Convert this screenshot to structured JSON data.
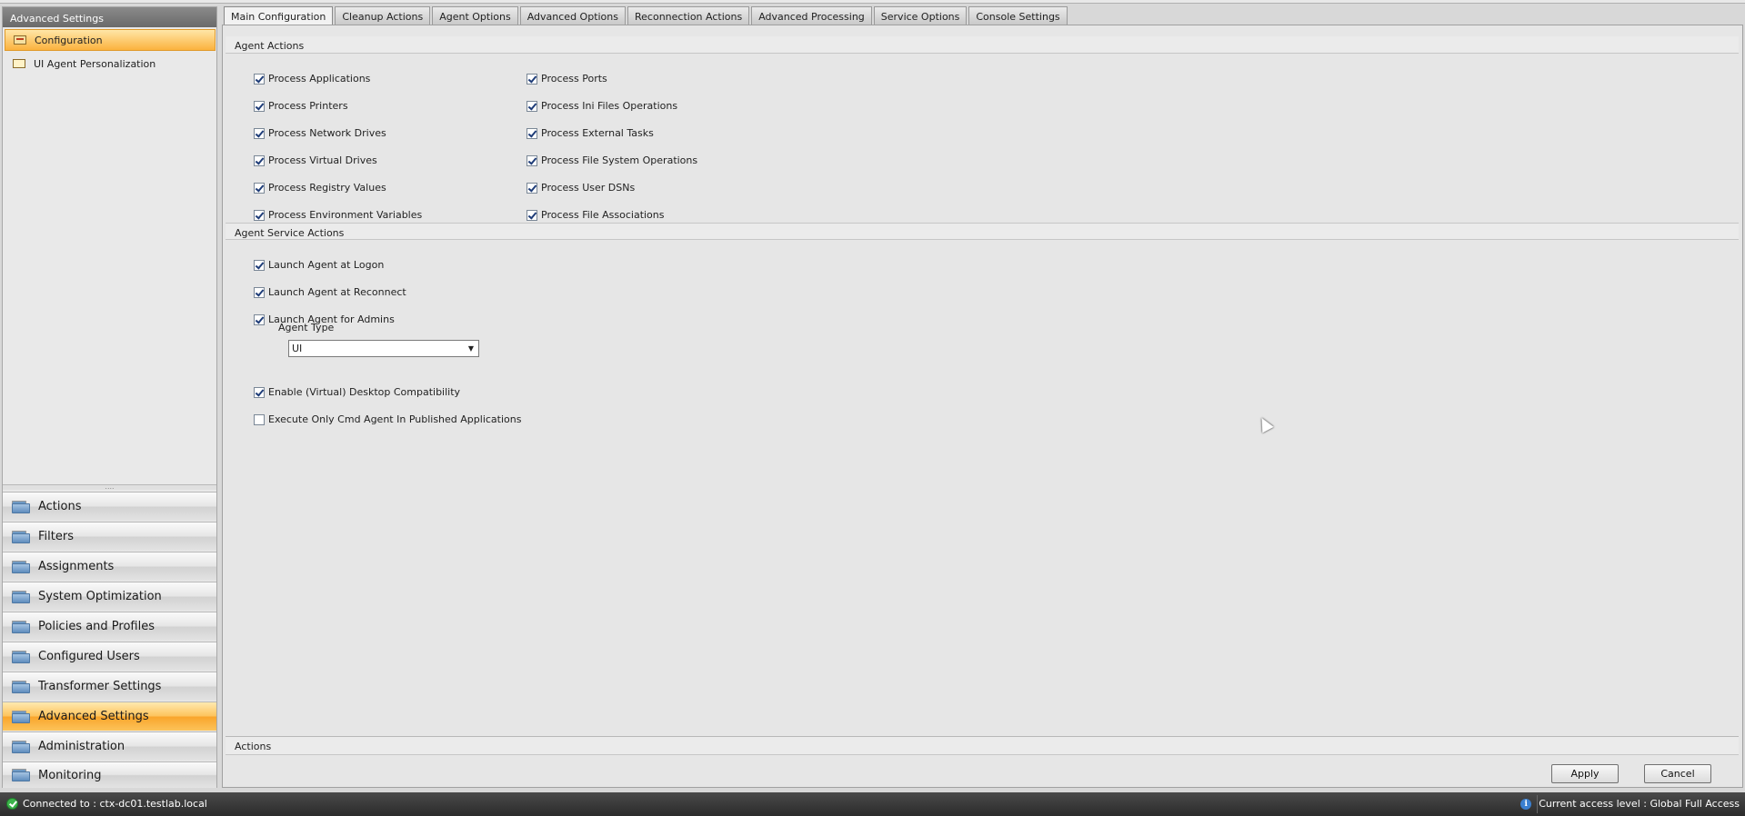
{
  "left_panel": {
    "title": "Advanced Settings",
    "tree": [
      {
        "label": "Configuration",
        "selected": true,
        "icon": "configuration-icon"
      },
      {
        "label": "UI Agent Personalization",
        "selected": false,
        "icon": "personalization-icon"
      }
    ],
    "nav": [
      {
        "label": "Actions",
        "icon": "folder-icon"
      },
      {
        "label": "Filters",
        "icon": "folder-icon"
      },
      {
        "label": "Assignments",
        "icon": "folder-icon"
      },
      {
        "label": "System Optimization",
        "icon": "folder-icon"
      },
      {
        "label": "Policies and Profiles",
        "icon": "folder-icon"
      },
      {
        "label": "Configured Users",
        "icon": "folder-icon"
      },
      {
        "label": "Transformer Settings",
        "icon": "folder-icon"
      },
      {
        "label": "Advanced Settings",
        "icon": "folder-icon",
        "active": true
      },
      {
        "label": "Administration",
        "icon": "folder-icon"
      },
      {
        "label": "Monitoring",
        "icon": "folder-icon"
      }
    ]
  },
  "tabs": [
    {
      "label": "Main Configuration",
      "active": true
    },
    {
      "label": "Cleanup Actions"
    },
    {
      "label": "Agent Options"
    },
    {
      "label": "Advanced Options"
    },
    {
      "label": "Reconnection Actions"
    },
    {
      "label": "Advanced Processing"
    },
    {
      "label": "Service Options"
    },
    {
      "label": "Console Settings"
    }
  ],
  "agent_actions": {
    "title": "Agent Actions",
    "col1": [
      {
        "label": "Process Applications",
        "checked": true
      },
      {
        "label": "Process Printers",
        "checked": true
      },
      {
        "label": "Process Network Drives",
        "checked": true
      },
      {
        "label": "Process Virtual Drives",
        "checked": true
      },
      {
        "label": "Process Registry Values",
        "checked": true
      },
      {
        "label": "Process Environment Variables",
        "checked": true
      }
    ],
    "col2": [
      {
        "label": "Process Ports",
        "checked": true
      },
      {
        "label": "Process Ini Files Operations",
        "checked": true
      },
      {
        "label": "Process External Tasks",
        "checked": true
      },
      {
        "label": "Process File System Operations",
        "checked": true
      },
      {
        "label": "Process User DSNs",
        "checked": true
      },
      {
        "label": "Process File Associations",
        "checked": true
      }
    ]
  },
  "agent_service_actions": {
    "title": "Agent Service Actions",
    "launch": [
      {
        "label": "Launch Agent at Logon",
        "checked": true
      },
      {
        "label": "Launch Agent at Reconnect",
        "checked": true
      },
      {
        "label": "Launch Agent for Admins",
        "checked": true
      }
    ],
    "agent_type_label": "Agent Type",
    "agent_type_value": "UI",
    "other": [
      {
        "label": "Enable (Virtual) Desktop Compatibility",
        "checked": true
      },
      {
        "label": "Execute Only Cmd Agent In Published Applications",
        "checked": false
      }
    ]
  },
  "actions_bar": {
    "title": "Actions",
    "apply": "Apply",
    "cancel": "Cancel"
  },
  "status": {
    "connected": "Connected to : ctx-dc01.testlab.local",
    "access": "Current access level  : Global Full Access"
  },
  "colors": {
    "selection": "#fbb23e",
    "status_bar": "#2b2b2b",
    "ok": "#3cb34a"
  }
}
